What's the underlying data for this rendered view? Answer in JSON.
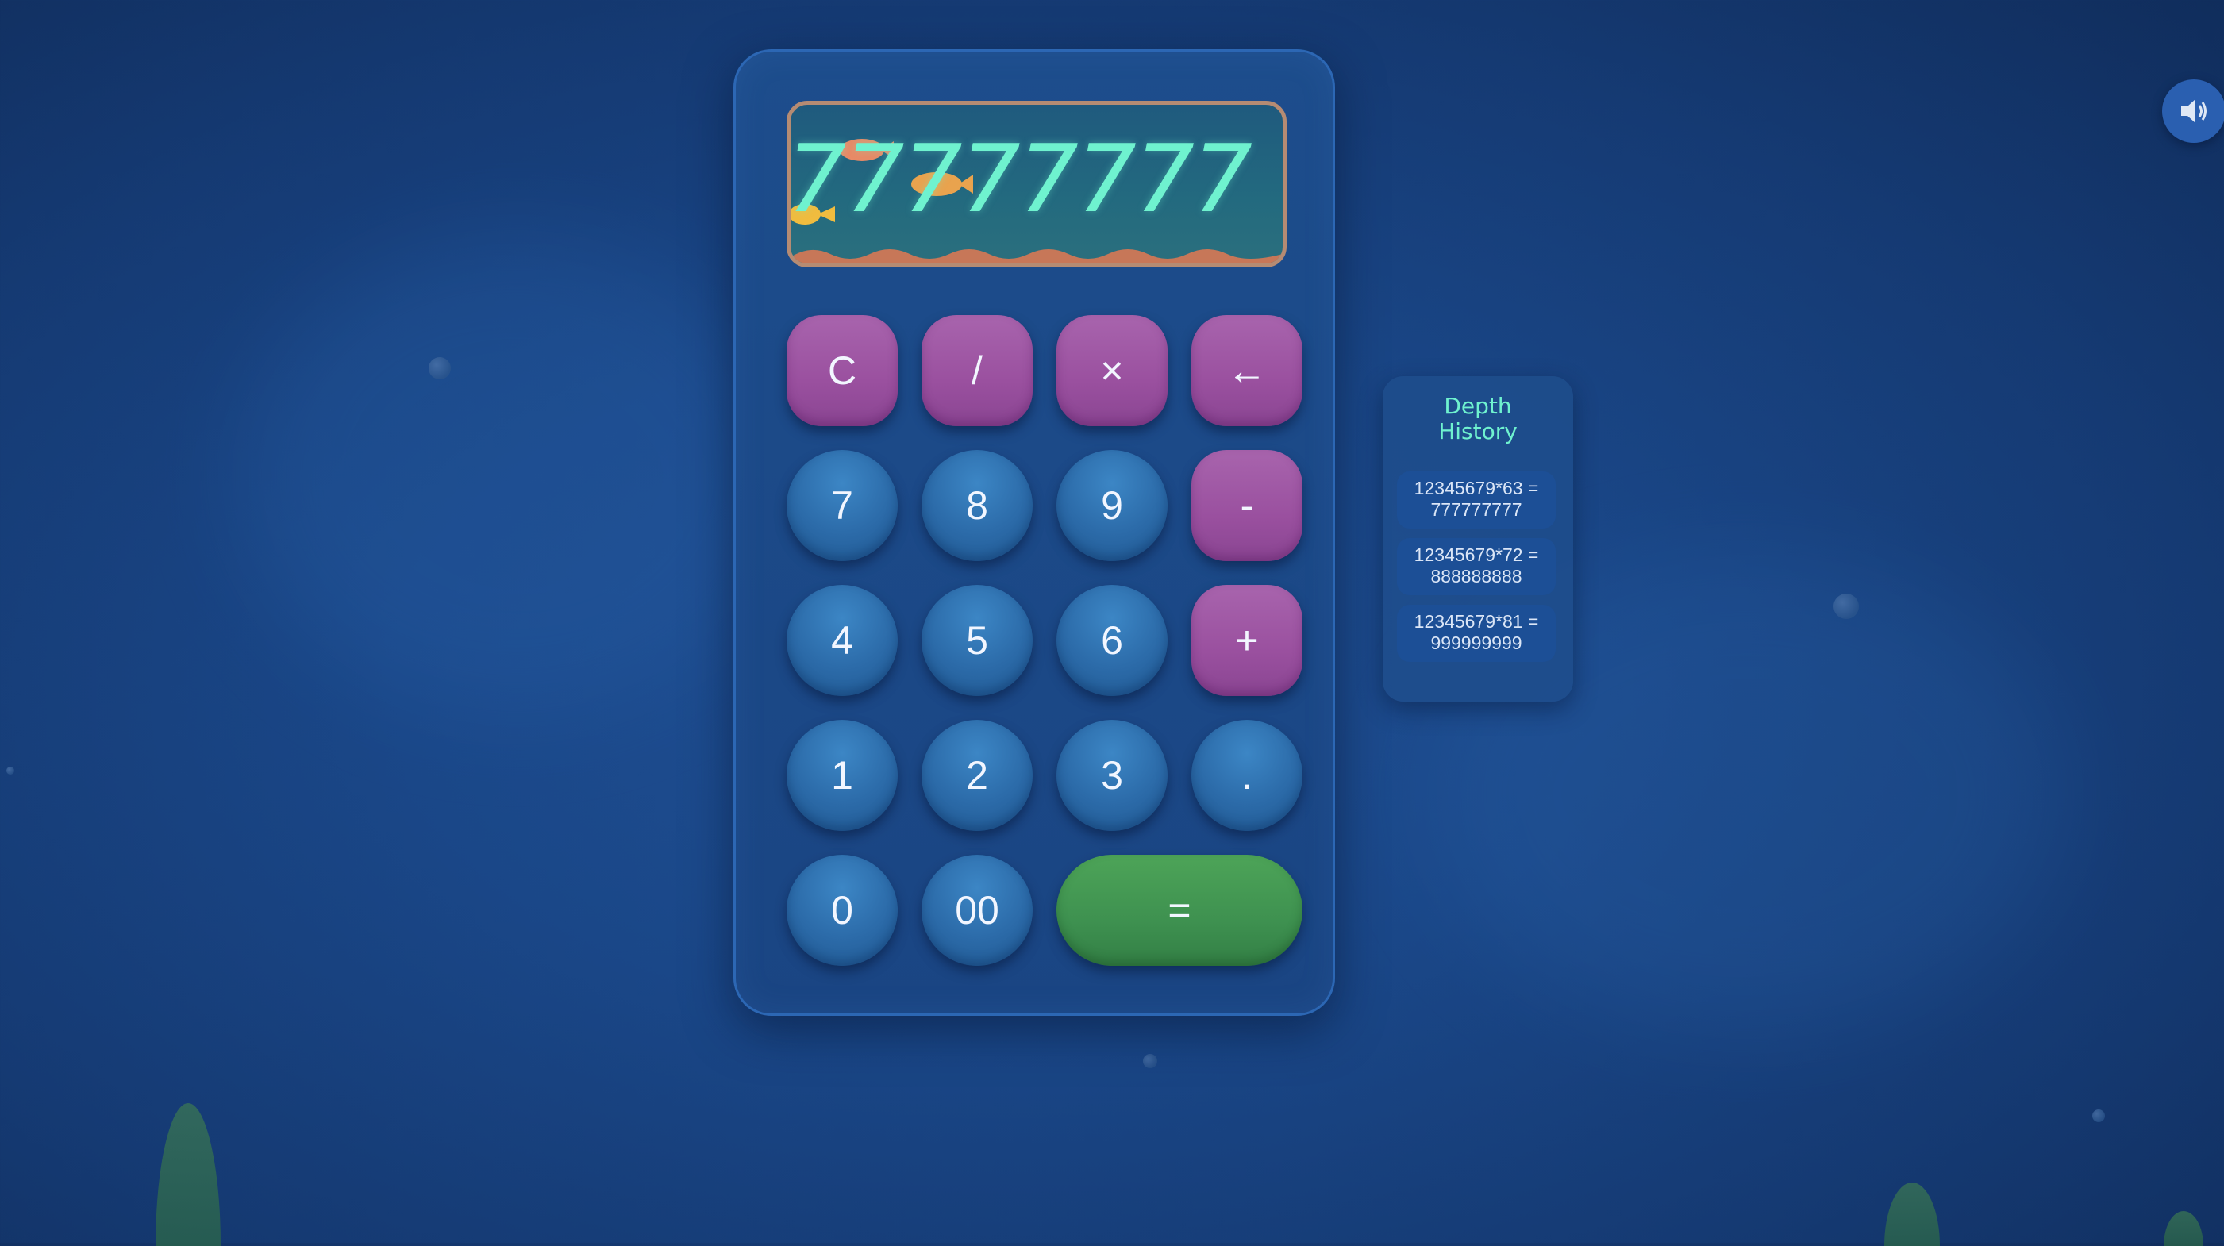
{
  "display": {
    "value": "777777777"
  },
  "keypad": {
    "clear": "C",
    "divide": "/",
    "multiply": "×",
    "backspace": "←",
    "subtract": "-",
    "add": "+",
    "decimal": ".",
    "equals": "=",
    "seven": "7",
    "eight": "8",
    "nine": "9",
    "four": "4",
    "five": "5",
    "six": "6",
    "one": "1",
    "two": "2",
    "three": "3",
    "zero": "0",
    "double_zero": "00"
  },
  "history": {
    "title": "Depth History",
    "items": [
      {
        "expression": "12345679*63 =",
        "result": "777777777"
      },
      {
        "expression": "12345679*72 =",
        "result": "888888888"
      },
      {
        "expression": "12345679*81 =",
        "result": "999999999"
      }
    ]
  },
  "icons": {
    "sound": "speaker-icon"
  },
  "colors": {
    "background": "#1a4788",
    "display_text": "#6ff2cf",
    "operator": "#9a509f",
    "number": "#2b6aa8",
    "equals": "#3e9150",
    "display_border": "#b58b73"
  }
}
